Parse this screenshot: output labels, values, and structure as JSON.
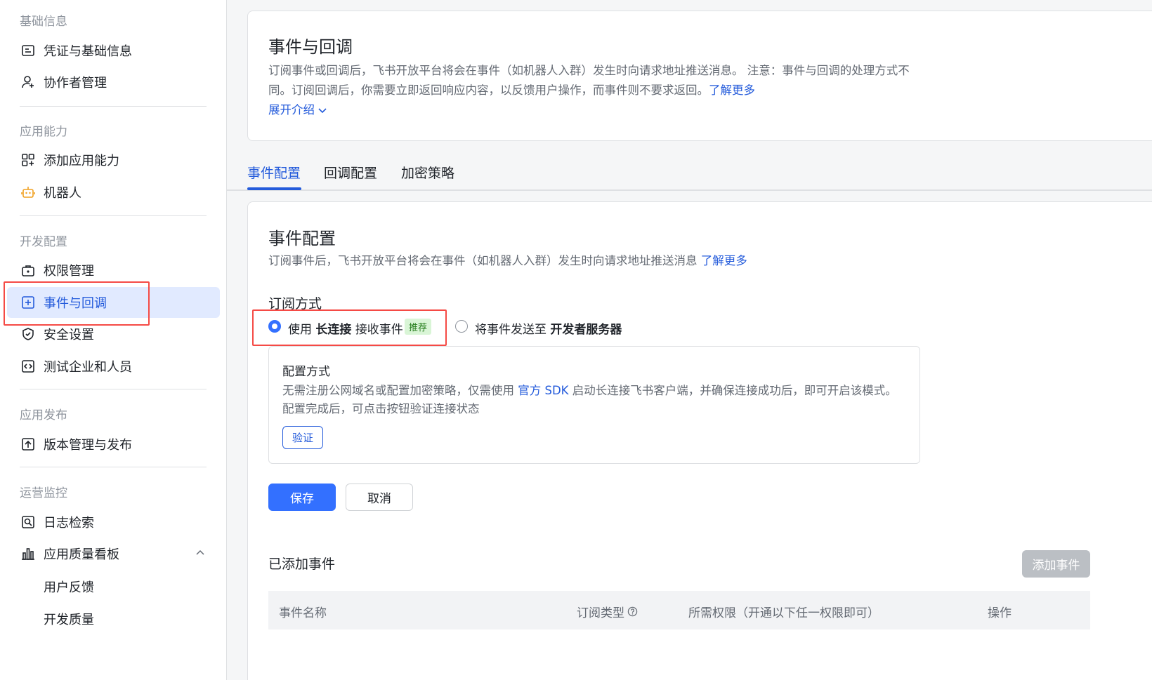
{
  "sidebar": {
    "sections": [
      {
        "title": "基础信息",
        "items": [
          {
            "label": "凭证与基础信息",
            "icon": "credential-icon"
          },
          {
            "label": "协作者管理",
            "icon": "add-user-icon"
          }
        ]
      },
      {
        "title": "应用能力",
        "items": [
          {
            "label": "添加应用能力",
            "icon": "add-app-icon"
          },
          {
            "label": "机器人",
            "icon": "robot-icon"
          }
        ]
      },
      {
        "title": "开发配置",
        "items": [
          {
            "label": "权限管理",
            "icon": "permission-icon"
          },
          {
            "label": "事件与回调",
            "icon": "event-icon",
            "active": true
          },
          {
            "label": "安全设置",
            "icon": "shield-icon"
          },
          {
            "label": "测试企业和人员",
            "icon": "test-icon"
          }
        ]
      },
      {
        "title": "应用发布",
        "items": [
          {
            "label": "版本管理与发布",
            "icon": "upload-icon"
          }
        ]
      },
      {
        "title": "运营监控",
        "items": [
          {
            "label": "日志检索",
            "icon": "log-search-icon"
          },
          {
            "label": "应用质量看板",
            "icon": "bar-chart-icon"
          }
        ],
        "subitems": [
          "用户反馈",
          "开发质量"
        ]
      }
    ]
  },
  "intro": {
    "title": "事件与回调",
    "desc_line1": "订阅事件或回调后，飞书开放平台将会在事件（如机器人入群）发生时向请求地址推送消息。 注意：事件与回调的处理方式不",
    "desc_line2": "同。订阅回调后，你需要立即返回响应内容，以反馈用户操作，而事件则不要求返回。",
    "learn_more": "了解更多",
    "expand": "展开介绍"
  },
  "tabs": [
    "事件配置",
    "回调配置",
    "加密策略"
  ],
  "event_config": {
    "title": "事件配置",
    "desc": "订阅事件后，飞书开放平台将会在事件（如机器人入群）发生时向请求地址推送消息",
    "learn_more": "了解更多",
    "subscribe_label": "订阅方式",
    "option1": {
      "prefix": "使用",
      "bold": "长连接",
      "suffix": "接收事件",
      "tag": "推荐"
    },
    "option2": {
      "prefix": "将事件发送至",
      "bold": "开发者服务器"
    },
    "config_box": {
      "title": "配置方式",
      "line1_prefix": "无需注册公网域名或配置加密策略，仅需使用",
      "line1_link": "官方 SDK",
      "line1_suffix": "启动长连接飞书客户端，并确保连接成功后，即可开启该模式。",
      "line2": "配置完成后，可点击按钮验证连接状态",
      "verify": "验证"
    },
    "save": "保存",
    "cancel": "取消"
  },
  "added_events": {
    "title": "已添加事件",
    "add_button": "添加事件",
    "columns": [
      "事件名称",
      "订阅类型",
      "所需权限（开通以下任一权限即可）",
      "操作"
    ]
  }
}
